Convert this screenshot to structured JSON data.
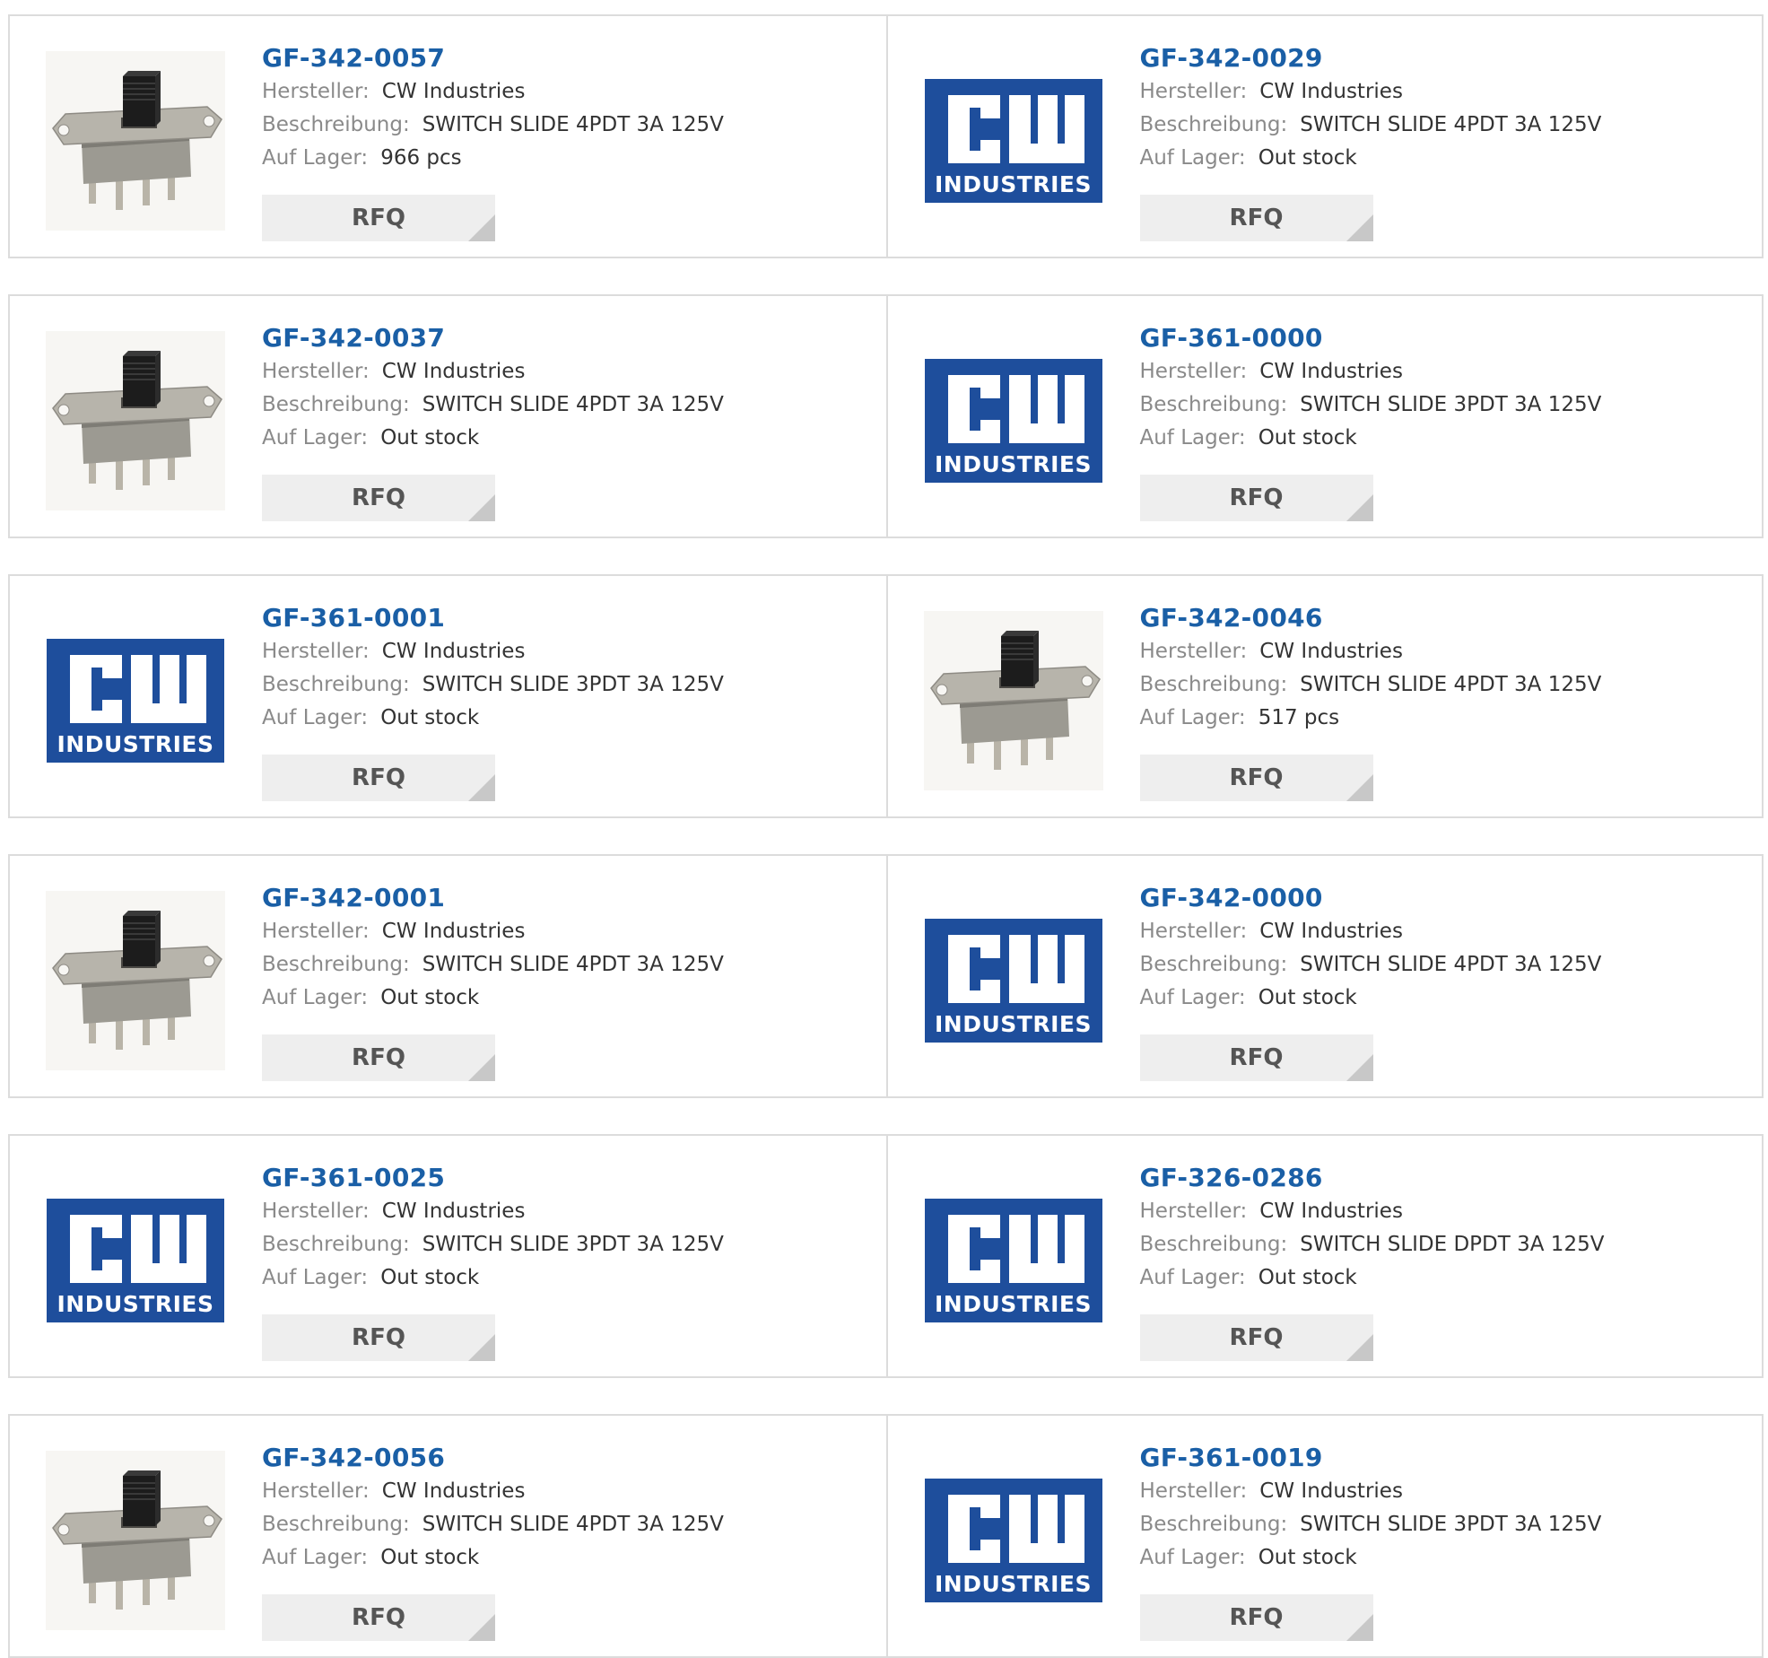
{
  "labels": {
    "manufacturer": "Hersteller:",
    "description": "Beschreibung:",
    "stock": "Auf Lager:",
    "rfq": "RFQ"
  },
  "logo_text": "INDUSTRIES",
  "products": [
    {
      "part": "GF-342-0057",
      "manufacturer": "CW Industries",
      "description": "SWITCH SLIDE 4PDT 3A 125V",
      "stock": "966 pcs",
      "image": "switch-photo"
    },
    {
      "part": "GF-342-0029",
      "manufacturer": "CW Industries",
      "description": "SWITCH SLIDE 4PDT 3A 125V",
      "stock": "Out stock",
      "image": "cw-logo"
    },
    {
      "part": "GF-342-0037",
      "manufacturer": "CW Industries",
      "description": "SWITCH SLIDE 4PDT 3A 125V",
      "stock": "Out stock",
      "image": "switch-photo"
    },
    {
      "part": "GF-361-0000",
      "manufacturer": "CW Industries",
      "description": "SWITCH SLIDE 3PDT 3A 125V",
      "stock": "Out stock",
      "image": "cw-logo"
    },
    {
      "part": "GF-361-0001",
      "manufacturer": "CW Industries",
      "description": "SWITCH SLIDE 3PDT 3A 125V",
      "stock": "Out stock",
      "image": "cw-logo"
    },
    {
      "part": "GF-342-0046",
      "manufacturer": "CW Industries",
      "description": "SWITCH SLIDE 4PDT 3A 125V",
      "stock": "517 pcs",
      "image": "switch-photo"
    },
    {
      "part": "GF-342-0001",
      "manufacturer": "CW Industries",
      "description": "SWITCH SLIDE 4PDT 3A 125V",
      "stock": "Out stock",
      "image": "switch-photo"
    },
    {
      "part": "GF-342-0000",
      "manufacturer": "CW Industries",
      "description": "SWITCH SLIDE 4PDT 3A 125V",
      "stock": "Out stock",
      "image": "cw-logo"
    },
    {
      "part": "GF-361-0025",
      "manufacturer": "CW Industries",
      "description": "SWITCH SLIDE 3PDT 3A 125V",
      "stock": "Out stock",
      "image": "cw-logo"
    },
    {
      "part": "GF-326-0286",
      "manufacturer": "CW Industries",
      "description": "SWITCH SLIDE DPDT 3A 125V",
      "stock": "Out stock",
      "image": "cw-logo"
    },
    {
      "part": "GF-342-0056",
      "manufacturer": "CW Industries",
      "description": "SWITCH SLIDE 4PDT 3A 125V",
      "stock": "Out stock",
      "image": "switch-photo"
    },
    {
      "part": "GF-361-0019",
      "manufacturer": "CW Industries",
      "description": "SWITCH SLIDE 3PDT 3A 125V",
      "stock": "Out stock",
      "image": "cw-logo"
    }
  ]
}
